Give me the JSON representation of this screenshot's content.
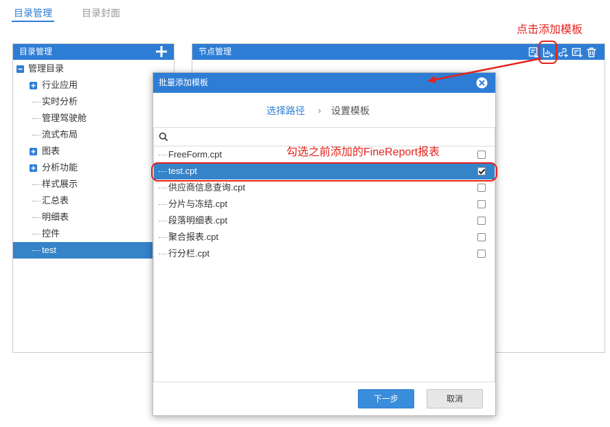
{
  "tabs": [
    {
      "label": "目录管理",
      "active": true
    },
    {
      "label": "目录封面",
      "active": false
    }
  ],
  "left_panel": {
    "title": "目录管理",
    "header_icon": "plus-icon",
    "tree_root": {
      "label": "管理目录",
      "icon": "collapse-box-icon",
      "expanded": true
    },
    "tree_items": [
      {
        "label": "行业应用",
        "expandable": true
      },
      {
        "label": "实时分析",
        "expandable": false
      },
      {
        "label": "管理驾驶舱",
        "expandable": false
      },
      {
        "label": "流式布局",
        "expandable": false
      },
      {
        "label": "图表",
        "expandable": true
      },
      {
        "label": "分析功能",
        "expandable": true
      },
      {
        "label": "样式展示",
        "expandable": false
      },
      {
        "label": "汇总表",
        "expandable": false
      },
      {
        "label": "明细表",
        "expandable": false
      },
      {
        "label": "控件",
        "expandable": false
      },
      {
        "label": "test",
        "expandable": false,
        "selected": true
      }
    ]
  },
  "right_panel": {
    "title": "节点管理",
    "toolbar_icons": [
      "report-file-icon",
      "chart-plus-icon",
      "link-plus-icon",
      "frame-plus-icon",
      "trash-icon"
    ]
  },
  "dialog": {
    "title": "批量添加模板",
    "close_icon": "close-circle-icon",
    "steps": [
      {
        "label": "选择路径",
        "active": true
      },
      {
        "label": "设置模板",
        "active": false
      }
    ],
    "step_separator": "›",
    "search": {
      "icon": "search-icon"
    },
    "files": [
      {
        "name": "FreeForm.cpt",
        "checked": false,
        "selected": false
      },
      {
        "name": "test.cpt",
        "checked": true,
        "selected": true
      },
      {
        "name": "供应商信息查询.cpt",
        "checked": false,
        "selected": false
      },
      {
        "name": "分片与冻结.cpt",
        "checked": false,
        "selected": false
      },
      {
        "name": "段落明细表.cpt",
        "checked": false,
        "selected": false
      },
      {
        "name": "聚合报表.cpt",
        "checked": false,
        "selected": false
      },
      {
        "name": "行分栏.cpt",
        "checked": false,
        "selected": false
      }
    ],
    "buttons": {
      "next": "下一步",
      "cancel": "取消"
    }
  },
  "annotations": {
    "toolbar_callout": "点击添加模板",
    "list_callout": "勾选之前添加的FineReport报表"
  },
  "colors": {
    "brand_blue": "#2e7dd5",
    "selected_row": "#3583c8",
    "annotation_red": "#e5221c",
    "inactive_tab": "#999999",
    "primary_button": "#3a8ddb"
  }
}
